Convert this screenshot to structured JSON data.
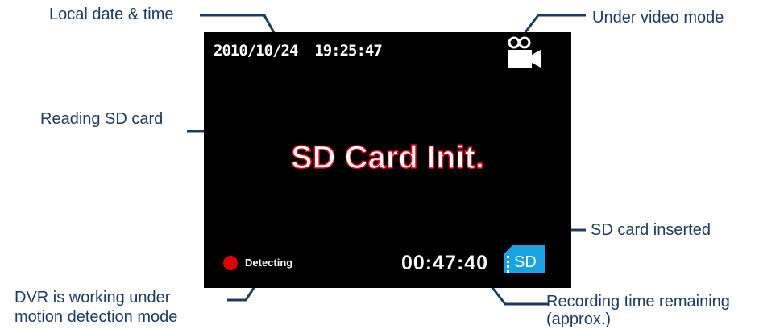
{
  "labels": {
    "datetime": "Local date & time",
    "video_mode": "Under video mode",
    "reading_sd": "Reading SD card",
    "sd_inserted": "SD card inserted",
    "dvr_line1": "DVR is working under",
    "dvr_line2": "motion detection  mode",
    "remaining_line1": "Recording time remaining",
    "remaining_line2": "(approx.)"
  },
  "screen": {
    "datetime": "2010/10/24  19:25:47",
    "status": "SD Card Init.",
    "detecting": "Detecting",
    "timer": "00:47:40",
    "sd_text": "SD"
  },
  "icons": [
    "video-camera-icon",
    "sd-card-icon",
    "record-dot-icon"
  ],
  "colors": {
    "label_text": "#1f3a5f",
    "leader_line": "#1f3a5f",
    "screen_bg": "#000000",
    "status_outline": "#e0001b",
    "record_dot": "#e00000",
    "sd_card": "#1aa3e0"
  }
}
